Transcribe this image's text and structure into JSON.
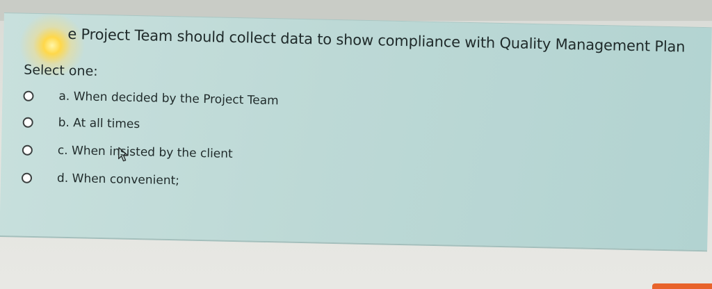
{
  "question": {
    "text": "e Project Team should collect data to show compliance with Quality Management Plan",
    "prompt": "Select one:",
    "options": [
      {
        "label": "a. When decided by the Project Team",
        "selected": false
      },
      {
        "label": "b. At all times",
        "selected": false
      },
      {
        "label": "c. When insisted by the client",
        "selected": false
      },
      {
        "label": "d. When convenient;",
        "selected": false
      }
    ]
  },
  "colors": {
    "panel": "#bdd9d6",
    "background": "#e2e3de",
    "accent": "#e8632b"
  },
  "icons": {
    "cursor": "mouse-cursor-icon",
    "radio": "radio-button-icon"
  }
}
